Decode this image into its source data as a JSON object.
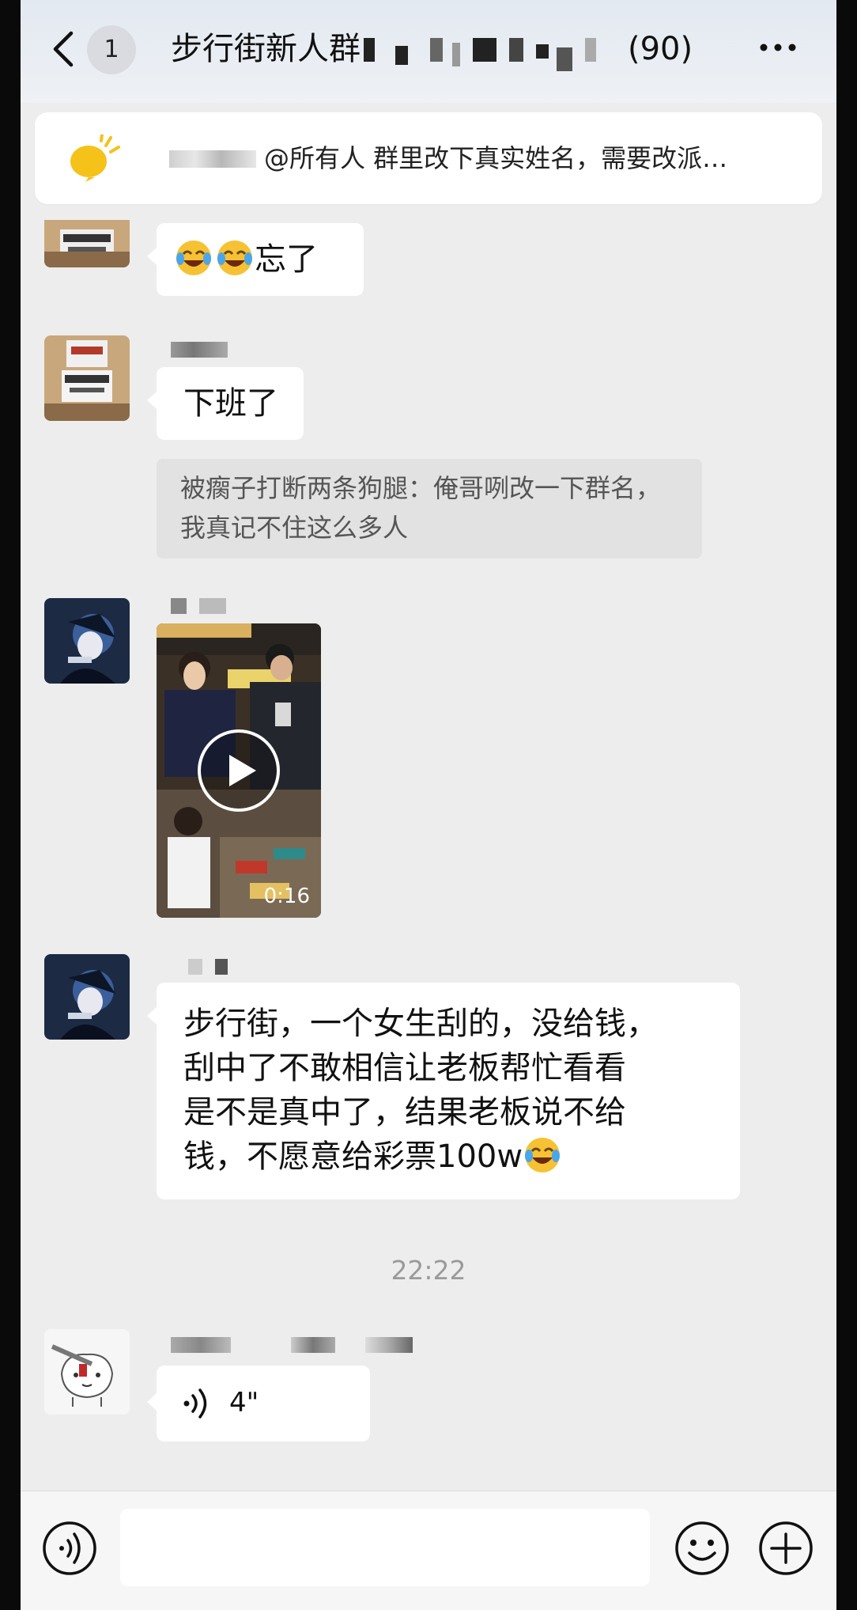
{
  "header": {
    "unread_count": "1",
    "title_prefix": "步行街新人群",
    "member_count": "(90)"
  },
  "notice": {
    "text": "@所有人 群里改下真实姓名，需要改派…"
  },
  "messages": [
    {
      "id": "m1",
      "type": "text",
      "text_after_emoji": "忘了"
    },
    {
      "id": "m2",
      "type": "text",
      "text": "下班了"
    },
    {
      "id": "m3",
      "type": "quote",
      "text": "被瘸子打断两条狗腿：俺哥咧改一下群名，我真记不住这么多人"
    },
    {
      "id": "m4",
      "type": "video",
      "duration": "0:16"
    },
    {
      "id": "m5",
      "type": "text",
      "lines": [
        "步行街，一个女生刮的，没给钱，",
        "刮中了不敢相信让老板帮忙看看",
        "是不是真中了，结果老板说不给",
        "钱，不愿意给彩票100w"
      ]
    },
    {
      "id": "m6",
      "type": "voice",
      "duration": "4\""
    }
  ],
  "timestamp": "22:22",
  "icons": {
    "back": "chevron-left-icon",
    "more": "more-dots-icon",
    "notice": "megaphone-icon",
    "voice_input": "voice-icon",
    "emoji": "emoji-icon",
    "plus": "plus-icon",
    "play": "play-icon",
    "laugh_cry": "laugh-cry-emoji-icon"
  },
  "colors": {
    "chat_bg": "#ededed",
    "bubble": "#ffffff",
    "quote_bg": "#e2e2e2",
    "notice_icon": "#f5c21a"
  }
}
